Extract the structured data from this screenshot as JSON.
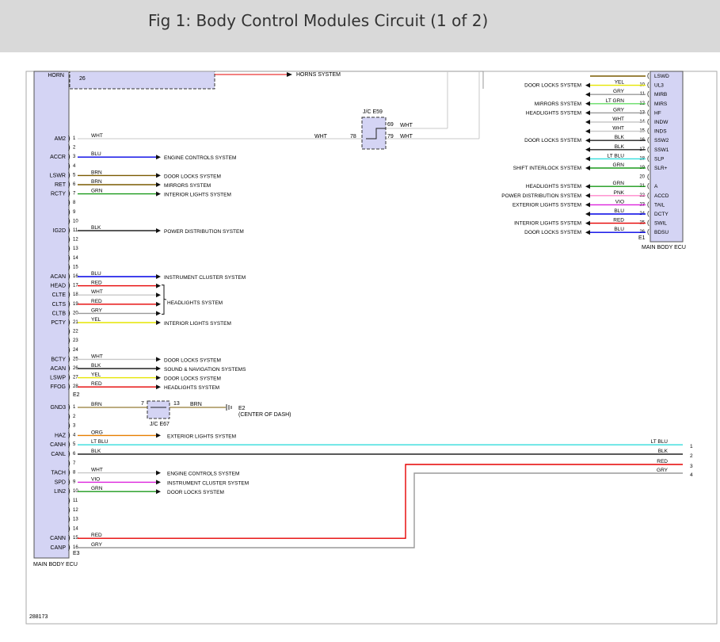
{
  "title": "Fig 1: Body Control Modules Circuit (1 of 2)",
  "footer_id": "288173",
  "horn": {
    "pin_label": "HORN",
    "pin_num": "26",
    "system": "HORNS SYSTEM"
  },
  "jc_e59": {
    "label": "J/C E59",
    "in_pin": "78",
    "out_pins": [
      "69",
      "79"
    ],
    "wire_in": "WHT",
    "wire_out": [
      "WHT",
      "WHT"
    ]
  },
  "jc_e67": {
    "label": "J/C E67",
    "in_pin": "7",
    "out_pin": "13",
    "wire_out": "BRN"
  },
  "ground": {
    "label": "E2",
    "sub": "(CENTER OF DASH)"
  },
  "left_ecu_label": "MAIN BODY ECU",
  "right_ecu_label": "MAIN BODY ECU",
  "connectors": {
    "e2": "E2",
    "e3": "E3",
    "e1": "E1"
  },
  "colors": {
    "WHT": "#c8c8c8",
    "BLU": "#0000e6",
    "BRN": "#7a5a00",
    "GRN": "#1a9a1a",
    "BLK": "#222222",
    "RED": "#e60000",
    "GRY": "#9a9a9a",
    "YEL": "#e6e600",
    "ORG": "#e67e00",
    "LT BLU": "#33dddd",
    "VIO": "#dd22dd",
    "PNK": "#ff88cc",
    "LT GRN": "#66dd66",
    "connector_fill": "#d4d4f4"
  },
  "left_block1": [
    {
      "pin": "1",
      "label": "AM2",
      "color": "WHT",
      "system": ""
    },
    {
      "pin": "2",
      "label": "",
      "color": "",
      "system": ""
    },
    {
      "pin": "3",
      "label": "ACCR",
      "color": "BLU",
      "system": "ENGINE CONTROLS SYSTEM"
    },
    {
      "pin": "4",
      "label": "",
      "color": "",
      "system": ""
    },
    {
      "pin": "5",
      "label": "LSWR",
      "color": "BRN",
      "system": "DOOR LOCKS SYSTEM"
    },
    {
      "pin": "6",
      "label": "RET",
      "color": "BRN",
      "system": "MIRRORS SYSTEM"
    },
    {
      "pin": "7",
      "label": "RCTY",
      "color": "GRN",
      "system": "INTERIOR LIGHTS SYSTEM"
    },
    {
      "pin": "8",
      "label": "",
      "color": "",
      "system": ""
    },
    {
      "pin": "9",
      "label": "",
      "color": "",
      "system": ""
    },
    {
      "pin": "10",
      "label": "",
      "color": "",
      "system": ""
    },
    {
      "pin": "11",
      "label": "IG2D",
      "color": "BLK",
      "system": "POWER DISTRIBUTION SYSTEM"
    },
    {
      "pin": "12",
      "label": "",
      "color": "",
      "system": ""
    },
    {
      "pin": "13",
      "label": "",
      "color": "",
      "system": ""
    },
    {
      "pin": "14",
      "label": "",
      "color": "",
      "system": ""
    },
    {
      "pin": "15",
      "label": "",
      "color": "",
      "system": ""
    },
    {
      "pin": "16",
      "label": "ACAN",
      "color": "BLU",
      "system": "INSTRUMENT CLUSTER SYSTEM"
    },
    {
      "pin": "17",
      "label": "HEAD",
      "color": "RED",
      "system": ""
    },
    {
      "pin": "18",
      "label": "CLTE",
      "color": "WHT",
      "system": ""
    },
    {
      "pin": "19",
      "label": "CLTS",
      "color": "RED",
      "system": "HEADLIGHTS SYSTEM"
    },
    {
      "pin": "20",
      "label": "CLTB",
      "color": "GRY",
      "system": ""
    },
    {
      "pin": "21",
      "label": "PCTY",
      "color": "YEL",
      "system": "INTERIOR LIGHTS SYSTEM"
    },
    {
      "pin": "22",
      "label": "",
      "color": "",
      "system": ""
    },
    {
      "pin": "23",
      "label": "",
      "color": "",
      "system": ""
    },
    {
      "pin": "24",
      "label": "",
      "color": "",
      "system": ""
    },
    {
      "pin": "25",
      "label": "BCTY",
      "color": "WHT",
      "system": "DOOR LOCKS SYSTEM"
    },
    {
      "pin": "26",
      "label": "ACAN",
      "color": "BLK",
      "system": "SOUND & NAVIGATION SYSTEMS"
    },
    {
      "pin": "27",
      "label": "LSWP",
      "color": "YEL",
      "system": "DOOR LOCKS SYSTEM"
    },
    {
      "pin": "28",
      "label": "FFOG",
      "color": "RED",
      "system": "HEADLIGHTS SYSTEM"
    }
  ],
  "left_block2": [
    {
      "pin": "1",
      "label": "GND3",
      "color": "BRN",
      "system": ""
    },
    {
      "pin": "2",
      "label": "",
      "color": "",
      "system": ""
    },
    {
      "pin": "3",
      "label": "",
      "color": "",
      "system": ""
    },
    {
      "pin": "4",
      "label": "HAZ",
      "color": "ORG",
      "system": "EXTERIOR LIGHTS SYSTEM"
    },
    {
      "pin": "5",
      "label": "CANH",
      "color": "LT BLU",
      "system": ""
    },
    {
      "pin": "6",
      "label": "CANL",
      "color": "BLK",
      "system": ""
    },
    {
      "pin": "7",
      "label": "",
      "color": "",
      "system": ""
    },
    {
      "pin": "8",
      "label": "TACH",
      "color": "WHT",
      "system": "ENGINE CONTROLS SYSTEM"
    },
    {
      "pin": "9",
      "label": "SPD",
      "color": "VIO",
      "system": "INSTRUMENT CLUSTER SYSTEM"
    },
    {
      "pin": "10",
      "label": "LIN2",
      "color": "GRN",
      "system": "DOOR LOCKS SYSTEM"
    },
    {
      "pin": "11",
      "label": "",
      "color": "",
      "system": ""
    },
    {
      "pin": "12",
      "label": "",
      "color": "",
      "system": ""
    },
    {
      "pin": "13",
      "label": "",
      "color": "",
      "system": ""
    },
    {
      "pin": "14",
      "label": "",
      "color": "",
      "system": ""
    },
    {
      "pin": "15",
      "label": "CANN",
      "color": "RED",
      "system": ""
    },
    {
      "pin": "16",
      "label": "CANP",
      "color": "GRY",
      "system": ""
    }
  ],
  "right_block": [
    {
      "pin": "",
      "label": "LSWD",
      "color": "",
      "system": ""
    },
    {
      "pin": "10",
      "label": "UL3",
      "color": "YEL",
      "system": "DOOR LOCKS SYSTEM"
    },
    {
      "pin": "11",
      "label": "MIRB",
      "color": "GRY",
      "system": ""
    },
    {
      "pin": "12",
      "label": "MIRS",
      "color": "LT GRN",
      "system": "MIRRORS SYSTEM"
    },
    {
      "pin": "13",
      "label": "HF",
      "color": "GRY",
      "system": "HEADLIGHTS SYSTEM"
    },
    {
      "pin": "14",
      "label": "INDW",
      "color": "WHT",
      "system": ""
    },
    {
      "pin": "15",
      "label": "INDS",
      "color": "WHT",
      "system": ""
    },
    {
      "pin": "16",
      "label": "SSW2",
      "color": "BLK",
      "system": "DOOR LOCKS SYSTEM"
    },
    {
      "pin": "17",
      "label": "SSW1",
      "color": "BLK",
      "system": ""
    },
    {
      "pin": "18",
      "label": "SLP",
      "color": "LT BLU",
      "system": ""
    },
    {
      "pin": "19",
      "label": "SLR+",
      "color": "GRN",
      "system": "SHIFT INTERLOCK SYSTEM"
    },
    {
      "pin": "20",
      "label": "",
      "color": "",
      "system": ""
    },
    {
      "pin": "21",
      "label": "A",
      "color": "GRN",
      "system": "HEADLIGHTS SYSTEM"
    },
    {
      "pin": "22",
      "label": "ACCD",
      "color": "PNK",
      "system": "POWER DISTRIBUTION SYSTEM"
    },
    {
      "pin": "23",
      "label": "TAIL",
      "color": "VIO",
      "system": "EXTERIOR LIGHTS SYSTEM"
    },
    {
      "pin": "24",
      "label": "DCTY",
      "color": "BLU",
      "system": ""
    },
    {
      "pin": "25",
      "label": "SWIL",
      "color": "RED",
      "system": "INTERIOR LIGHTS SYSTEM"
    },
    {
      "pin": "26",
      "label": "BDSU",
      "color": "BLU",
      "system": "DOOR LOCKS SYSTEM"
    }
  ],
  "outputs": [
    {
      "num": "1",
      "color": "LT BLU"
    },
    {
      "num": "2",
      "color": "BLK"
    },
    {
      "num": "3",
      "color": "RED"
    },
    {
      "num": "4",
      "color": "GRY"
    }
  ]
}
